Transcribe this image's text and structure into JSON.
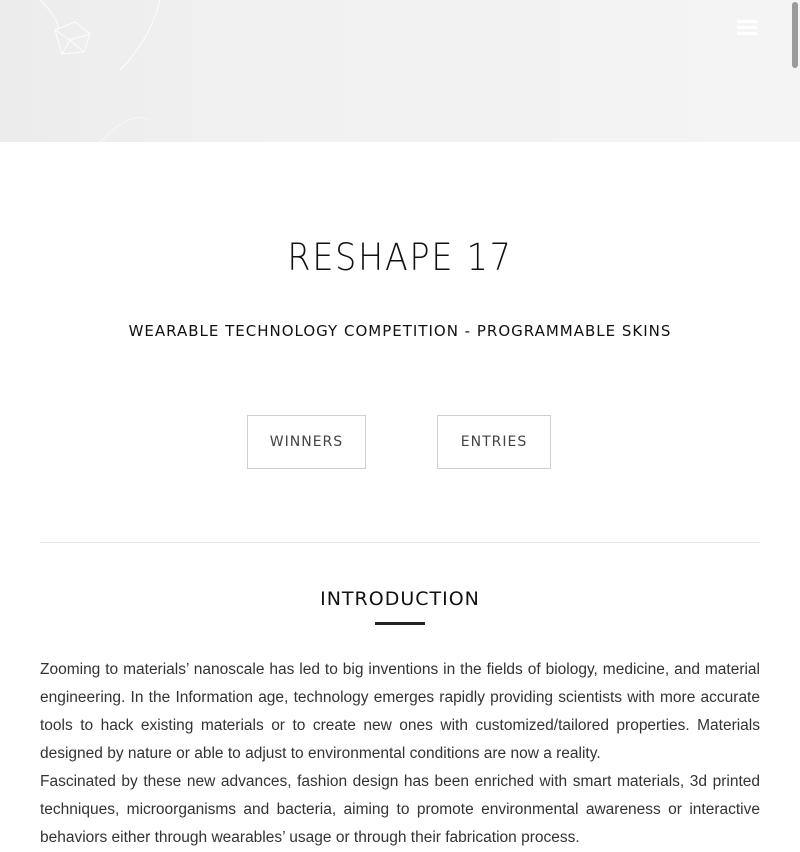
{
  "header": {
    "menu_icon": "hamburger-menu-icon"
  },
  "hero": {
    "title": "RESHAPE 17",
    "subtitle": "WEARABLE TECHNOLOGY COMPETITION - PROGRAMMABLE SKINS"
  },
  "buttons": {
    "winners_label": "WINNERS",
    "entries_label": "ENTRIES"
  },
  "introduction": {
    "heading": "INTRODUCTION",
    "paragraphs": [
      "Zooming to materials’ nanoscale has led to big inventions in the fields of biology, medicine, and material engineering.  In the Information age, technology emerges rapidly providing scientists with more accurate tools to hack existing materials or to create new ones with customized/tailored properties. Materials designed by nature or able to adjust to environmental conditions are now a reality.",
      "Fascinated by these new advances, fashion design has been enriched with smart materials, 3d printed techniques, microorganisms and bacteria, aiming to promote environmental awareness or interactive behaviors either through wearables’ usage or through their fabrication process."
    ]
  }
}
